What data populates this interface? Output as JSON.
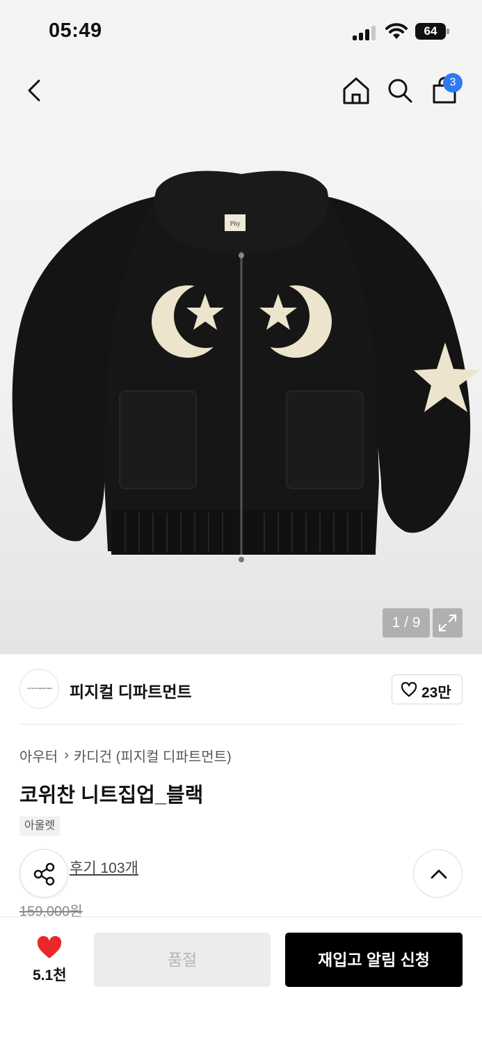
{
  "status_bar": {
    "time": "05:49",
    "battery": "64"
  },
  "header": {
    "cart_count": "3"
  },
  "gallery": {
    "counter": "1 / 9",
    "image_logo_text": "Phy"
  },
  "brand": {
    "name": "피지컬 디파트먼트",
    "logo_text": "PHYSICAL DEPARTMENT",
    "favorites": "23만"
  },
  "breadcrumb": {
    "category": "아우터",
    "sub_category": "카디건 (피지컬 디파트먼트)"
  },
  "product": {
    "title": "코위찬 니트집업_블랙",
    "tag": "아울렛",
    "reviews": "후기 103개",
    "original_price": "159,000원"
  },
  "bottom_bar": {
    "likes": "5.1천",
    "soldout_label": "품절",
    "restock_label": "재입고 알림 신청"
  },
  "colors": {
    "accent_blue": "#2f7af0",
    "heart_red": "#e8282b",
    "black": "#000000"
  }
}
